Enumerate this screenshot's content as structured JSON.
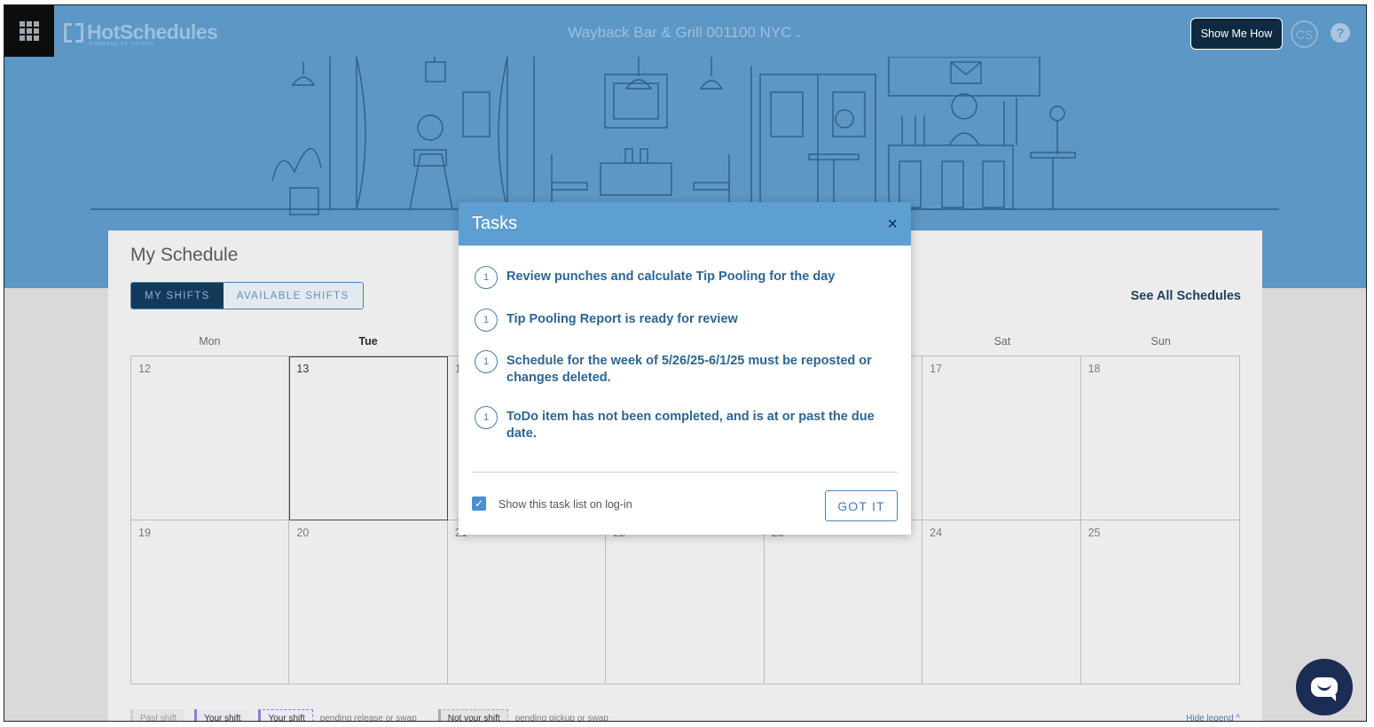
{
  "topbar": {
    "brand": "HotSchedules",
    "brand_sub": "POWERED BY FOURTH",
    "location": "Wayback Bar & Grill 001100 NYC",
    "location_caret": "⌄",
    "show_me_how": "Show Me How",
    "avatar_initials": "CS",
    "help_symbol": "?"
  },
  "schedule": {
    "title": "My Schedule",
    "tabs": [
      {
        "label": "MY SHIFTS",
        "active": true
      },
      {
        "label": "AVAILABLE SHIFTS",
        "active": false
      }
    ],
    "see_all": "See All Schedules",
    "weekdays": [
      "Mon",
      "Tue",
      "",
      "",
      "",
      "Sat",
      "Sun"
    ],
    "week1": [
      "12",
      "13",
      "1",
      "",
      "",
      "17",
      "18"
    ],
    "week2": [
      "19",
      "20",
      "21",
      "22",
      "23",
      "24",
      "25"
    ]
  },
  "legend": {
    "past_shift": "Past shift",
    "your_shift": "Your shift",
    "your_shift_pending": "Your shift",
    "pending_release": "pending release or swap",
    "not_your_shift": "Not your shift",
    "pending_pickup": "pending pickup or swap",
    "hide_legend": "Hide legend",
    "hide_caret": "^"
  },
  "modal": {
    "title": "Tasks",
    "close": "×",
    "tasks": [
      {
        "count": "1",
        "text": "Review punches and calculate Tip Pooling for the day"
      },
      {
        "count": "1",
        "text": "Tip Pooling Report is ready for review"
      },
      {
        "count": "1",
        "text": "Schedule for the week of 5/26/25-6/1/25 must be reposted or changes deleted."
      },
      {
        "count": "1",
        "text": "ToDo item has not been completed, and is at or past the due date."
      }
    ],
    "checkbox_mark": "✓",
    "checkbox_label": "Show this task list on log-in",
    "checkbox_checked": true,
    "got_it": "GOT IT"
  },
  "colors": {
    "header_blue": "#5c97c6",
    "modal_header": "#5e9fd1",
    "navy": "#133a5a",
    "chat_button": "#1c2d55"
  }
}
